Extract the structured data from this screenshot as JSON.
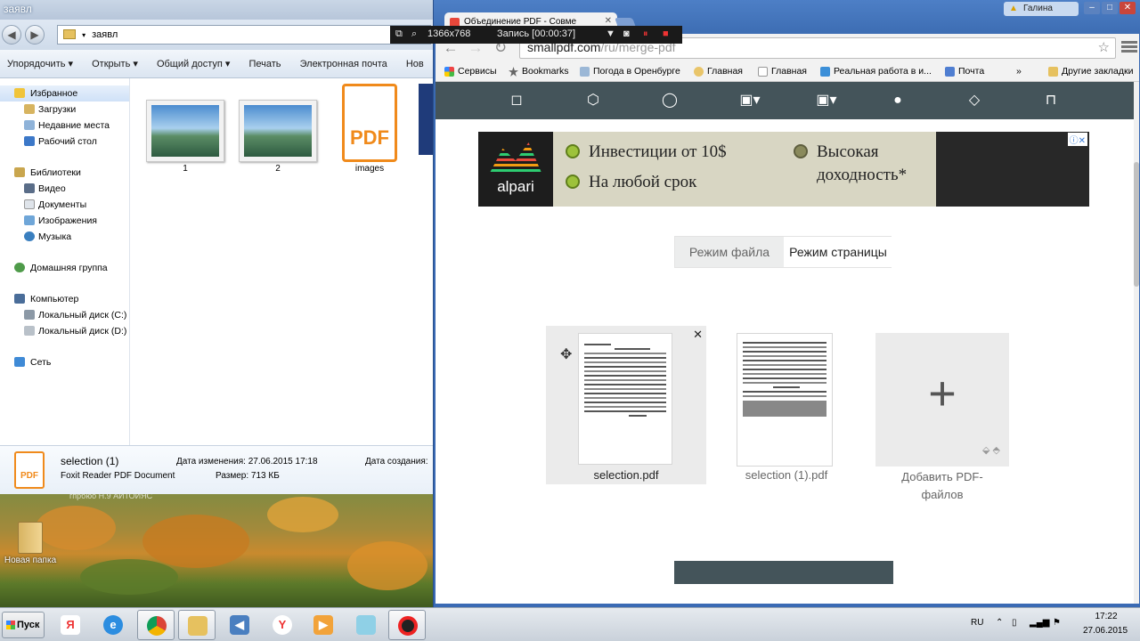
{
  "explorer": {
    "title": "заявл",
    "address": "заявл",
    "toolbar": [
      "Упорядочить ▾",
      "Открыть ▾",
      "Общий доступ ▾",
      "Печать",
      "Электронная почта",
      "Нов"
    ],
    "nav": {
      "favorites": "Избранное",
      "fav_items": [
        "Загрузки",
        "Недавние места",
        "Рабочий стол"
      ],
      "libraries": "Библиотеки",
      "lib_items": [
        "Видео",
        "Документы",
        "Изображения",
        "Музыка"
      ],
      "homegroup": "Домашняя группа",
      "computer": "Компьютер",
      "comp_items": [
        "Локальный диск (C:)",
        "Локальный диск (D:)"
      ],
      "network": "Сеть"
    },
    "files": [
      "1",
      "2",
      "images"
    ],
    "pdf_icon_text": "PDF",
    "details": {
      "name": "selection (1)",
      "type": "Foxit Reader PDF Document",
      "modified_label": "Дата изменения: 27.06.2015 17:18",
      "size_label": "Размер: 713 КБ",
      "created_label": "Дата создания:",
      "icon_text": "PDF"
    }
  },
  "desktop": {
    "folder_label": "Новая папка",
    "hidden_text": "гпрбюо Н.9    АЙТОЙЯС"
  },
  "recorder": {
    "resolution": "1366x768",
    "status": "Запись [00:00:37]"
  },
  "browser": {
    "tab_title": "Объединение PDF - Совме",
    "user_name": "Галина",
    "url_host": "smallpdf.com",
    "url_path": "/ru/merge-pdf",
    "bookmarks": [
      "Сервисы",
      "Bookmarks",
      "Погода в Оренбурге",
      "Главная",
      "Главная",
      "Реальная работа в и...",
      "Почта",
      "»",
      "Другие закладки"
    ]
  },
  "page": {
    "ad": {
      "brand": "alpari",
      "line1": "Инвестиции от 10$",
      "line2": "На любой срок",
      "line3": "Высокая",
      "line4": "доходность*",
      "badge": "ⓘ✕"
    },
    "modes": {
      "file": "Режим файла",
      "page": "Режим страницы"
    },
    "files": [
      "selection.pdf",
      "selection (1).pdf"
    ],
    "add_label_1": "Добавить PDF-",
    "add_label_2": "файлов"
  },
  "taskbar": {
    "start": "Пуск",
    "lang": "RU",
    "time": "17:22",
    "date": "27.06.2015"
  }
}
